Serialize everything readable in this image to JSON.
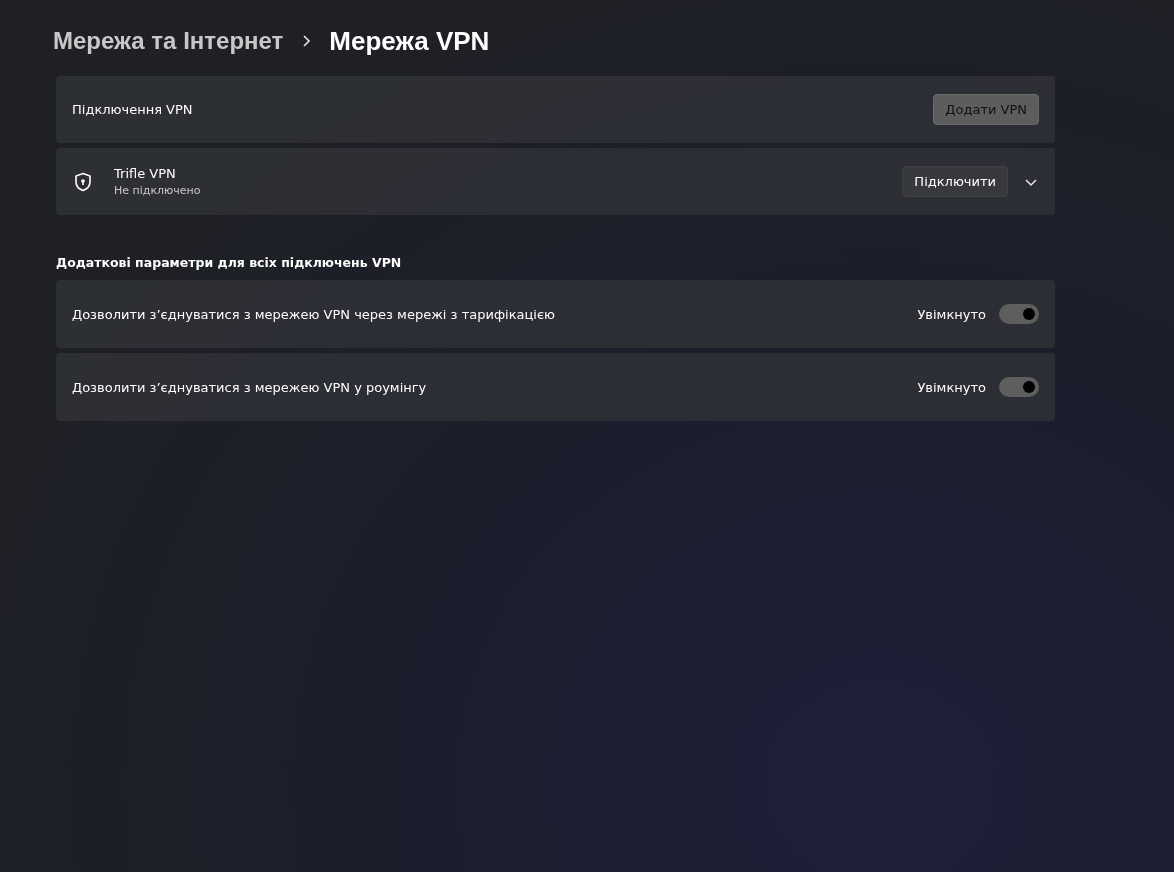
{
  "breadcrumb": {
    "parent": "Мережа та Інтернет",
    "current": "Мережа VPN"
  },
  "vpn_connections": {
    "label": "Підключення VPN",
    "add_button": "Додати VPN"
  },
  "connections": [
    {
      "name": "Trifle VPN",
      "status": "Не підключено",
      "button": "Підключити",
      "expanded": false
    }
  ],
  "advanced": {
    "heading": "Додаткові параметри для всіх підключень VPN",
    "settings": [
      {
        "label": "Дозволити з’єднуватися з мережею VPN через мережі з тарифікацією",
        "state_text": "Увімкнуто",
        "on": true
      },
      {
        "label": "Дозволити з’єднуватися з мережею VPN у роумінгу",
        "state_text": "Увімкнуто",
        "on": true
      }
    ]
  }
}
